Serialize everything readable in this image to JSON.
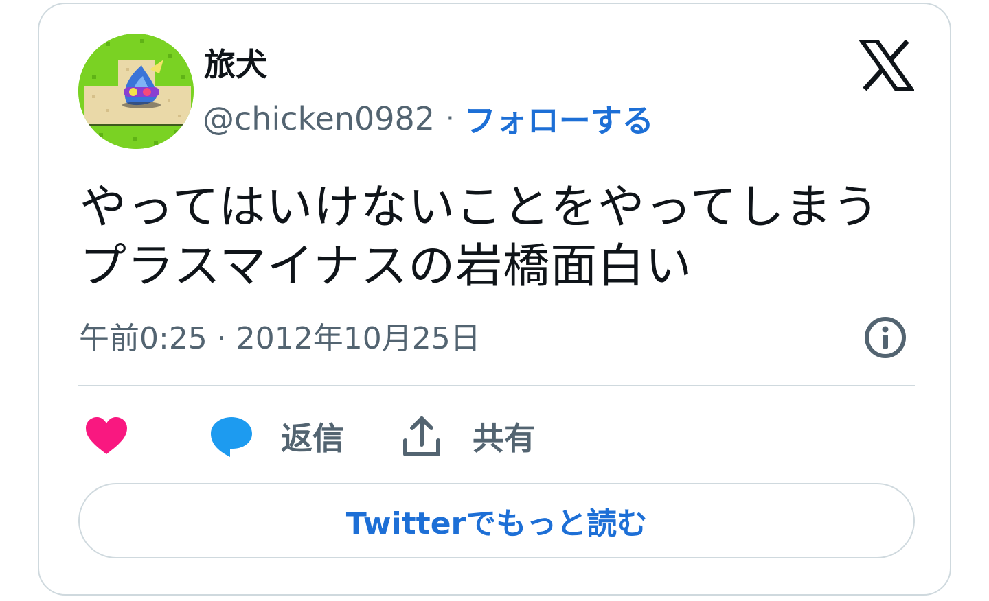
{
  "author": {
    "display_name": "旅犬",
    "handle": "@chicken0982",
    "separator": "·",
    "follow_label": "フォローする"
  },
  "tweet": {
    "text": "やってはいけないことをやってしまうプラスマイナスの岩橋面白い",
    "timestamp": "午前0:25 · 2012年10月25日"
  },
  "actions": {
    "reply_label": "返信",
    "share_label": "共有"
  },
  "read_more_label": "Twitterでもっと読む",
  "colors": {
    "follow_blue": "#1d6fd6",
    "heart_pink": "#f91880",
    "reply_blue": "#1d9bf0",
    "secondary_text": "#536471",
    "border": "#cfd9de"
  },
  "icons": {
    "brand": "x-logo-icon",
    "info": "info-icon",
    "like": "heart-icon",
    "reply": "speech-bubble-icon",
    "share": "share-upload-icon"
  }
}
